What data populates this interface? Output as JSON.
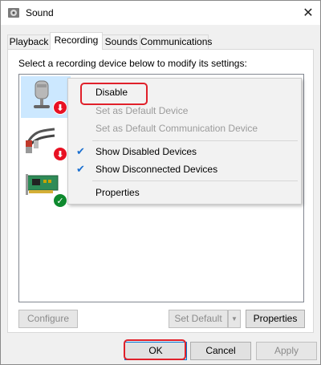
{
  "window": {
    "title": "Sound",
    "icon": "speaker-icon"
  },
  "tabs": [
    {
      "label": "Playback",
      "active": false
    },
    {
      "label": "Recording",
      "active": true
    },
    {
      "label": "Sounds",
      "active": false
    },
    {
      "label": "Communications",
      "active": false
    }
  ],
  "panel": {
    "instruction": "Select a recording device below to modify its settings:"
  },
  "devices": [
    {
      "icon": "microphone-icon",
      "status": "disabled"
    },
    {
      "icon": "line-in-icon",
      "status": "disabled"
    },
    {
      "icon": "sound-card-icon",
      "status": "default"
    }
  ],
  "context_menu": {
    "items": [
      {
        "label": "Disable",
        "enabled": true,
        "checked": false
      },
      {
        "label": "Set as Default Device",
        "enabled": false,
        "checked": false
      },
      {
        "label": "Set as Default Communication Device",
        "enabled": false,
        "checked": false
      },
      {
        "label": "Show Disabled Devices",
        "enabled": true,
        "checked": true
      },
      {
        "label": "Show Disconnected Devices",
        "enabled": true,
        "checked": true
      },
      {
        "label": "Properties",
        "enabled": true,
        "checked": false
      }
    ]
  },
  "panel_buttons": {
    "configure": "Configure",
    "set_default": "Set Default",
    "properties": "Properties"
  },
  "dialog_buttons": {
    "ok": "OK",
    "cancel": "Cancel",
    "apply": "Apply"
  },
  "colors": {
    "highlight": "#e0202a",
    "selection": "#cce8ff",
    "check": "#1a6fd0"
  }
}
